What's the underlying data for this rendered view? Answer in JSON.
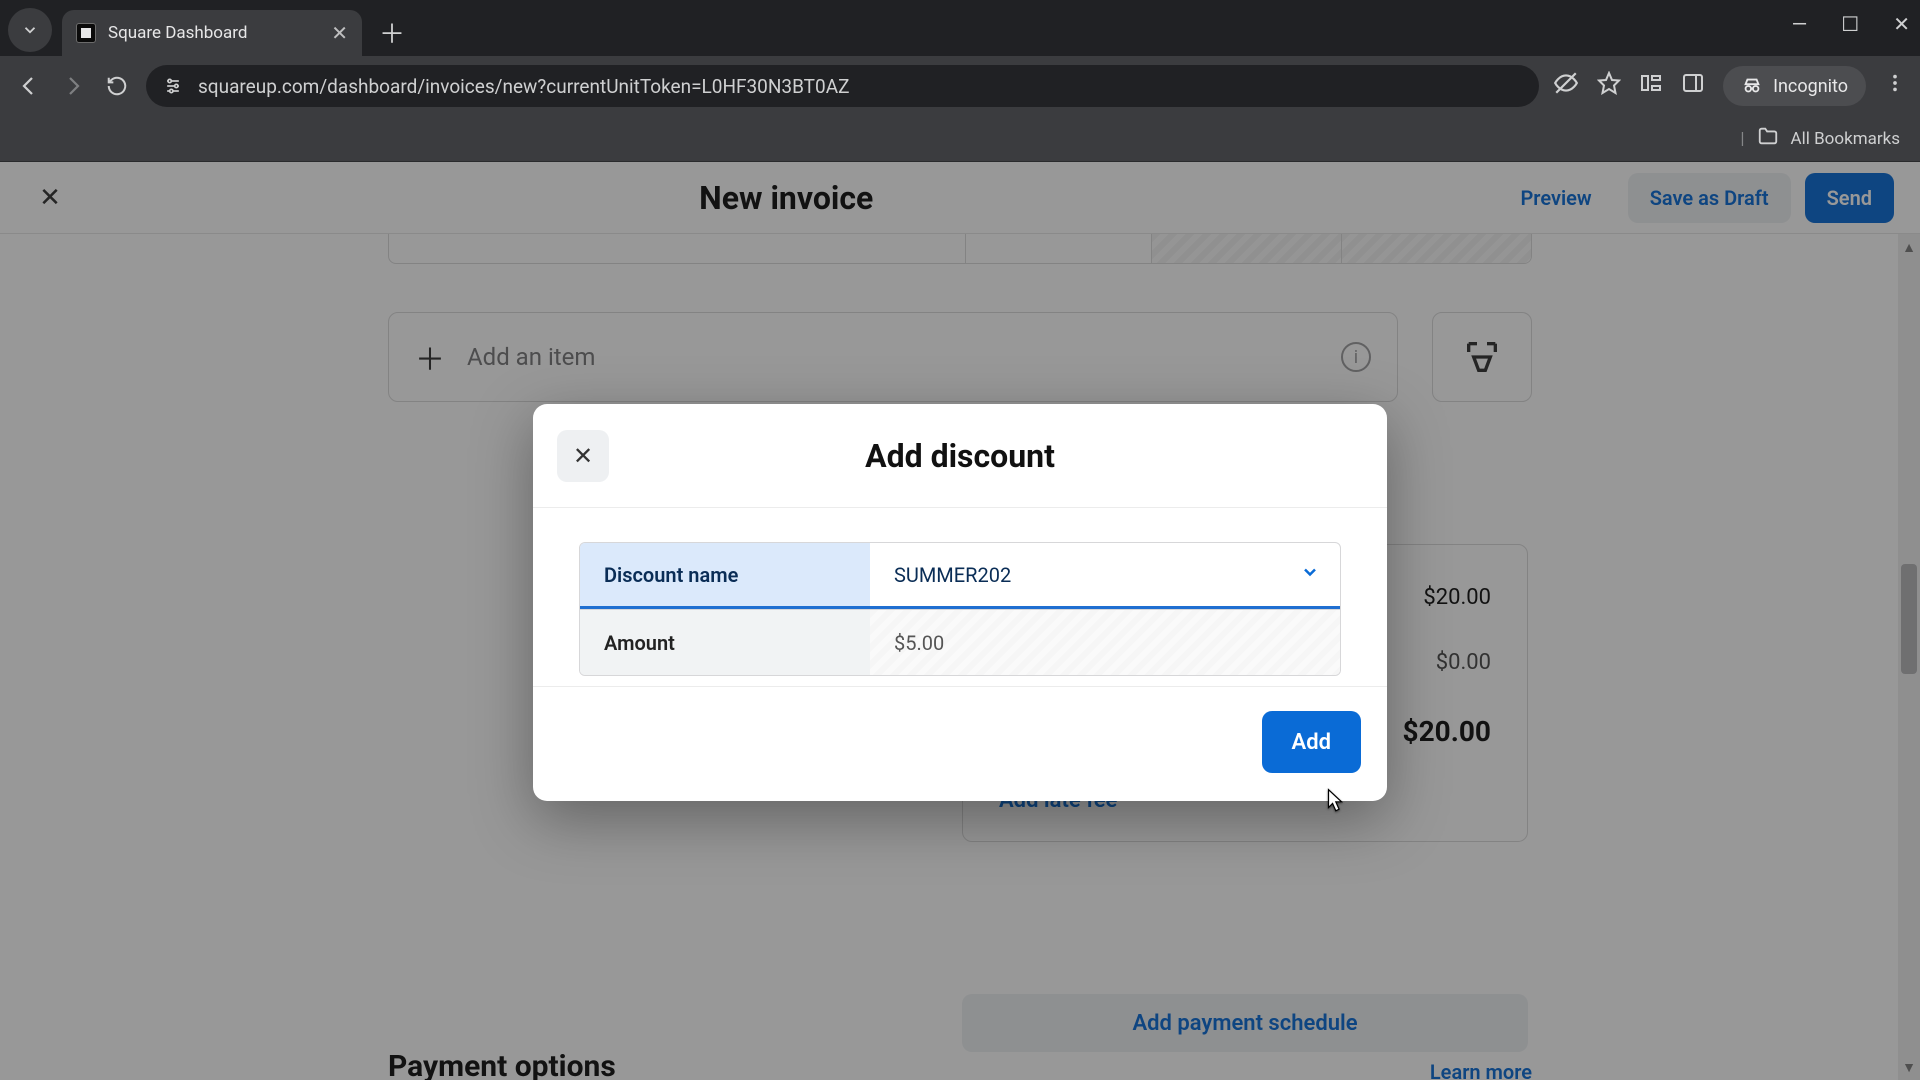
{
  "browser": {
    "tab_title": "Square Dashboard",
    "url": "squareup.com/dashboard/invoices/new?currentUnitToken=L0HF30N3BT0AZ",
    "incognito_label": "Incognito",
    "all_bookmarks": "All Bookmarks"
  },
  "header": {
    "title": "New invoice",
    "preview": "Preview",
    "save_draft": "Save as Draft",
    "send": "Send"
  },
  "page": {
    "add_item_placeholder": "Add an item",
    "summary_amount1": "$20.00",
    "summary_amount2": "$0.00",
    "summary_total": "$20.00",
    "add_late_fee": "Add late fee",
    "add_payment_schedule": "Add payment schedule",
    "payment_options_heading": "Payment options",
    "learn_more": "Learn more"
  },
  "modal": {
    "title": "Add discount",
    "discount_name_label": "Discount name",
    "discount_name_value": "SUMMER202",
    "amount_label": "Amount",
    "amount_value": "$5.00",
    "add_button": "Add"
  }
}
